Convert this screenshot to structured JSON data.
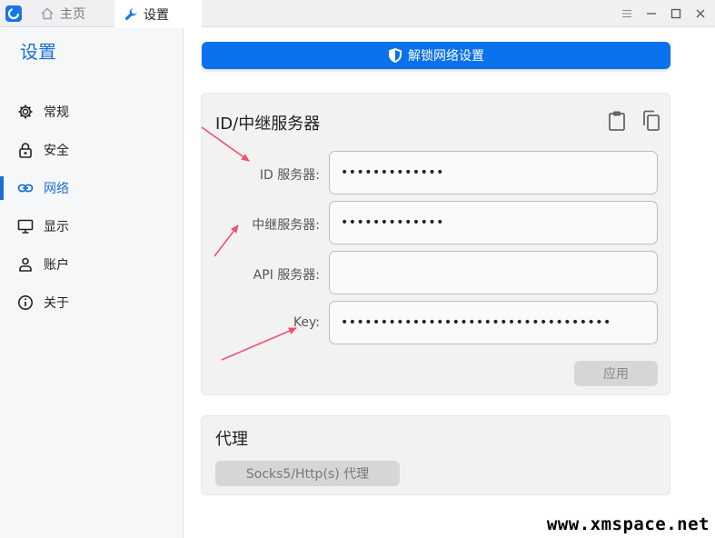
{
  "titlebar": {
    "tabs": [
      {
        "label": "主页",
        "icon": "home-icon"
      },
      {
        "label": "设置",
        "icon": "wrench-icon"
      }
    ],
    "controls": [
      "menu-icon",
      "minimize-icon",
      "maximize-icon",
      "close-icon"
    ]
  },
  "sidebar": {
    "title": "设置",
    "items": [
      {
        "label": "常规",
        "icon": "gear-icon"
      },
      {
        "label": "安全",
        "icon": "lock-icon"
      },
      {
        "label": "网络",
        "icon": "link-icon",
        "active": true
      },
      {
        "label": "显示",
        "icon": "monitor-icon"
      },
      {
        "label": "账户",
        "icon": "person-icon"
      },
      {
        "label": "关于",
        "icon": "info-icon"
      }
    ]
  },
  "main": {
    "unlock_label": "解锁网络设置",
    "id_card": {
      "title": "ID/中继服务器",
      "fields": [
        {
          "label": "ID 服务器:",
          "value": "•••••••••••••"
        },
        {
          "label": "中继服务器:",
          "value": "•••••••••••••"
        },
        {
          "label": "API 服务器:",
          "value": ""
        },
        {
          "label": "Key:",
          "value": "••••••••••••••••••••••••••••••••••"
        }
      ],
      "apply_label": "应用"
    },
    "proxy_card": {
      "title": "代理",
      "button_label": "Socks5/Http(s) 代理"
    }
  },
  "watermark": "www.xmspace.net",
  "colors": {
    "accent": "#1b6fd1",
    "primary_button": "#0a71ec",
    "annotation_arrow": "#f0506e"
  }
}
